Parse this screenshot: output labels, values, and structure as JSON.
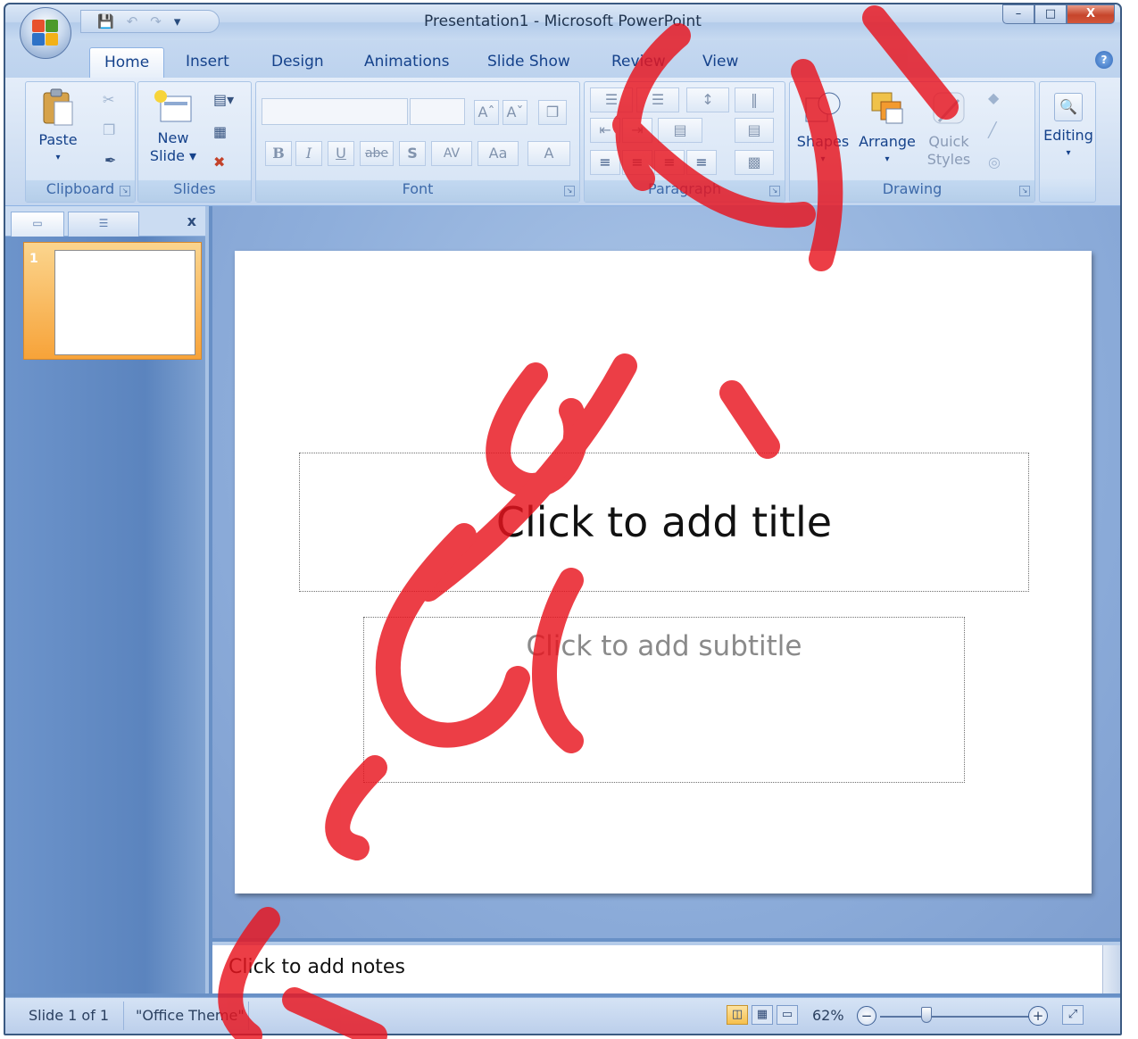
{
  "window": {
    "title": "Presentation1 - Microsoft PowerPoint",
    "minimize": "–",
    "maximize": "□",
    "close": "X"
  },
  "qat": {
    "save": "💾",
    "undo": "↶",
    "redo": "↷",
    "more": "▾"
  },
  "tabs": [
    "Home",
    "Insert",
    "Design",
    "Animations",
    "Slide Show",
    "Review",
    "View"
  ],
  "help": "?",
  "ribbon": {
    "clipboard": {
      "label": "Clipboard",
      "paste": "Paste",
      "paste_arrow": "▾",
      "cut": "✂",
      "copy": "❐",
      "painter": "✒"
    },
    "slides": {
      "label": "Slides",
      "new_slide_line1": "New",
      "new_slide_line2": "Slide ▾",
      "layout": "▤▾",
      "reset": "▦",
      "delete": "✖"
    },
    "font": {
      "label": "Font",
      "font_name": "",
      "font_size": "",
      "grow": "Aˆ",
      "shrink": "Aˇ",
      "clear": "❒",
      "bold": "B",
      "italic": "I",
      "underline": "U",
      "strike": "abe",
      "shadow": "S",
      "spacing": "AV",
      "case": "Aa",
      "color": "A"
    },
    "paragraph": {
      "label": "Paragraph",
      "bullets": "☰",
      "numbering": "☰",
      "line_spacing": "↕",
      "columns": "‖",
      "dec_indent": "⇤",
      "inc_indent": "⇥",
      "text_dir": "▤",
      "align": "▤",
      "smartart": "▩",
      "align_left": "≡",
      "center": "≡",
      "align_right": "≡",
      "justify": "≡"
    },
    "drawing": {
      "label": "Drawing",
      "shapes": "Shapes",
      "arrange": "Arrange",
      "quick_styles_1": "Quick",
      "quick_styles_2": "Styles",
      "fill": "◆",
      "outline": "╱",
      "effects": "◎"
    },
    "editing": {
      "label": "Editing",
      "icon": "🔍"
    }
  },
  "leftpane": {
    "slide_number": "1",
    "close": "x"
  },
  "slide": {
    "title_placeholder": "Click to add title",
    "subtitle_placeholder": "Click to add subtitle"
  },
  "notes": {
    "placeholder": "Click to add notes"
  },
  "status": {
    "slide_info": "Slide 1 of 1",
    "theme": "\"Office Theme\"",
    "zoom": "62%",
    "zoom_out": "−",
    "zoom_in": "+",
    "fit": "⤢"
  },
  "colors": {
    "accent": "#15428b",
    "ribbon": "#d1e0f3",
    "watermark": "#e8141e"
  }
}
